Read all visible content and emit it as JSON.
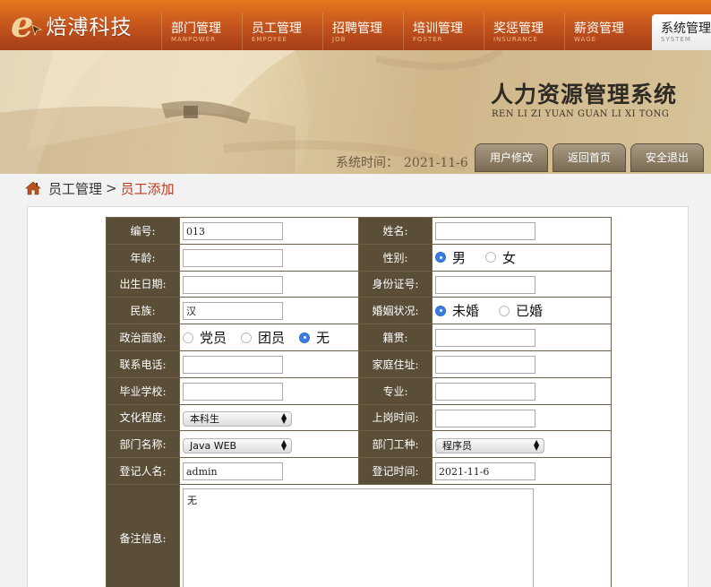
{
  "logo": {
    "text": "焙溥科技"
  },
  "nav": [
    {
      "cn": "部门管理",
      "en": "MANPOWER"
    },
    {
      "cn": "员工管理",
      "en": "EMPOYEE"
    },
    {
      "cn": "招聘管理",
      "en": "JOB"
    },
    {
      "cn": "培训管理",
      "en": "FOSTER"
    },
    {
      "cn": "奖惩管理",
      "en": "INSURANCE"
    },
    {
      "cn": "薪资管理",
      "en": "WAGE"
    },
    {
      "cn": "系统管理",
      "en": "SYSTEM"
    }
  ],
  "banner": {
    "title": "人力资源管理系统",
    "subtitle": "REN LI ZI YUAN GUAN LI XI TONG",
    "time_label": "系统时间：",
    "time_value": "2021-11-6",
    "buttons": [
      "用户修改",
      "返回首页",
      "安全退出"
    ]
  },
  "breadcrumb": {
    "parent": "员工管理",
    "separator": ">",
    "current": "员工添加"
  },
  "form": {
    "labels": {
      "id": "编号:",
      "name": "姓名:",
      "age": "年龄:",
      "gender": "性别:",
      "birth": "出生日期:",
      "idcard": "身份证号:",
      "ethnic": "民族:",
      "marital": "婚姻状况:",
      "political": "政治面貌:",
      "native": "籍贯:",
      "phone": "联系电话:",
      "address": "家庭住址:",
      "school": "毕业学校:",
      "major": "专业:",
      "education": "文化程度:",
      "start_time": "上岗时间:",
      "dept": "部门名称:",
      "job_type": "部门工种:",
      "registrar": "登记人名:",
      "reg_time": "登记时间:",
      "remark": "备注信息:"
    },
    "values": {
      "id": "013",
      "name": "",
      "age": "",
      "birth": "",
      "idcard": "",
      "ethnic": "汉",
      "native": "",
      "phone": "",
      "address": "",
      "school": "",
      "major": "",
      "start_time": "",
      "registrar": "admin",
      "reg_time": "2021-11-6",
      "remark": "无"
    },
    "gender_options": [
      "男",
      "女"
    ],
    "gender_selected": "男",
    "marital_options": [
      "未婚",
      "已婚"
    ],
    "marital_selected": "未婚",
    "political_options": [
      "党员",
      "团员",
      "无"
    ],
    "political_selected": "无",
    "education_selected": "本科生",
    "dept_selected": "Java WEB",
    "job_type_selected": "程序员"
  }
}
